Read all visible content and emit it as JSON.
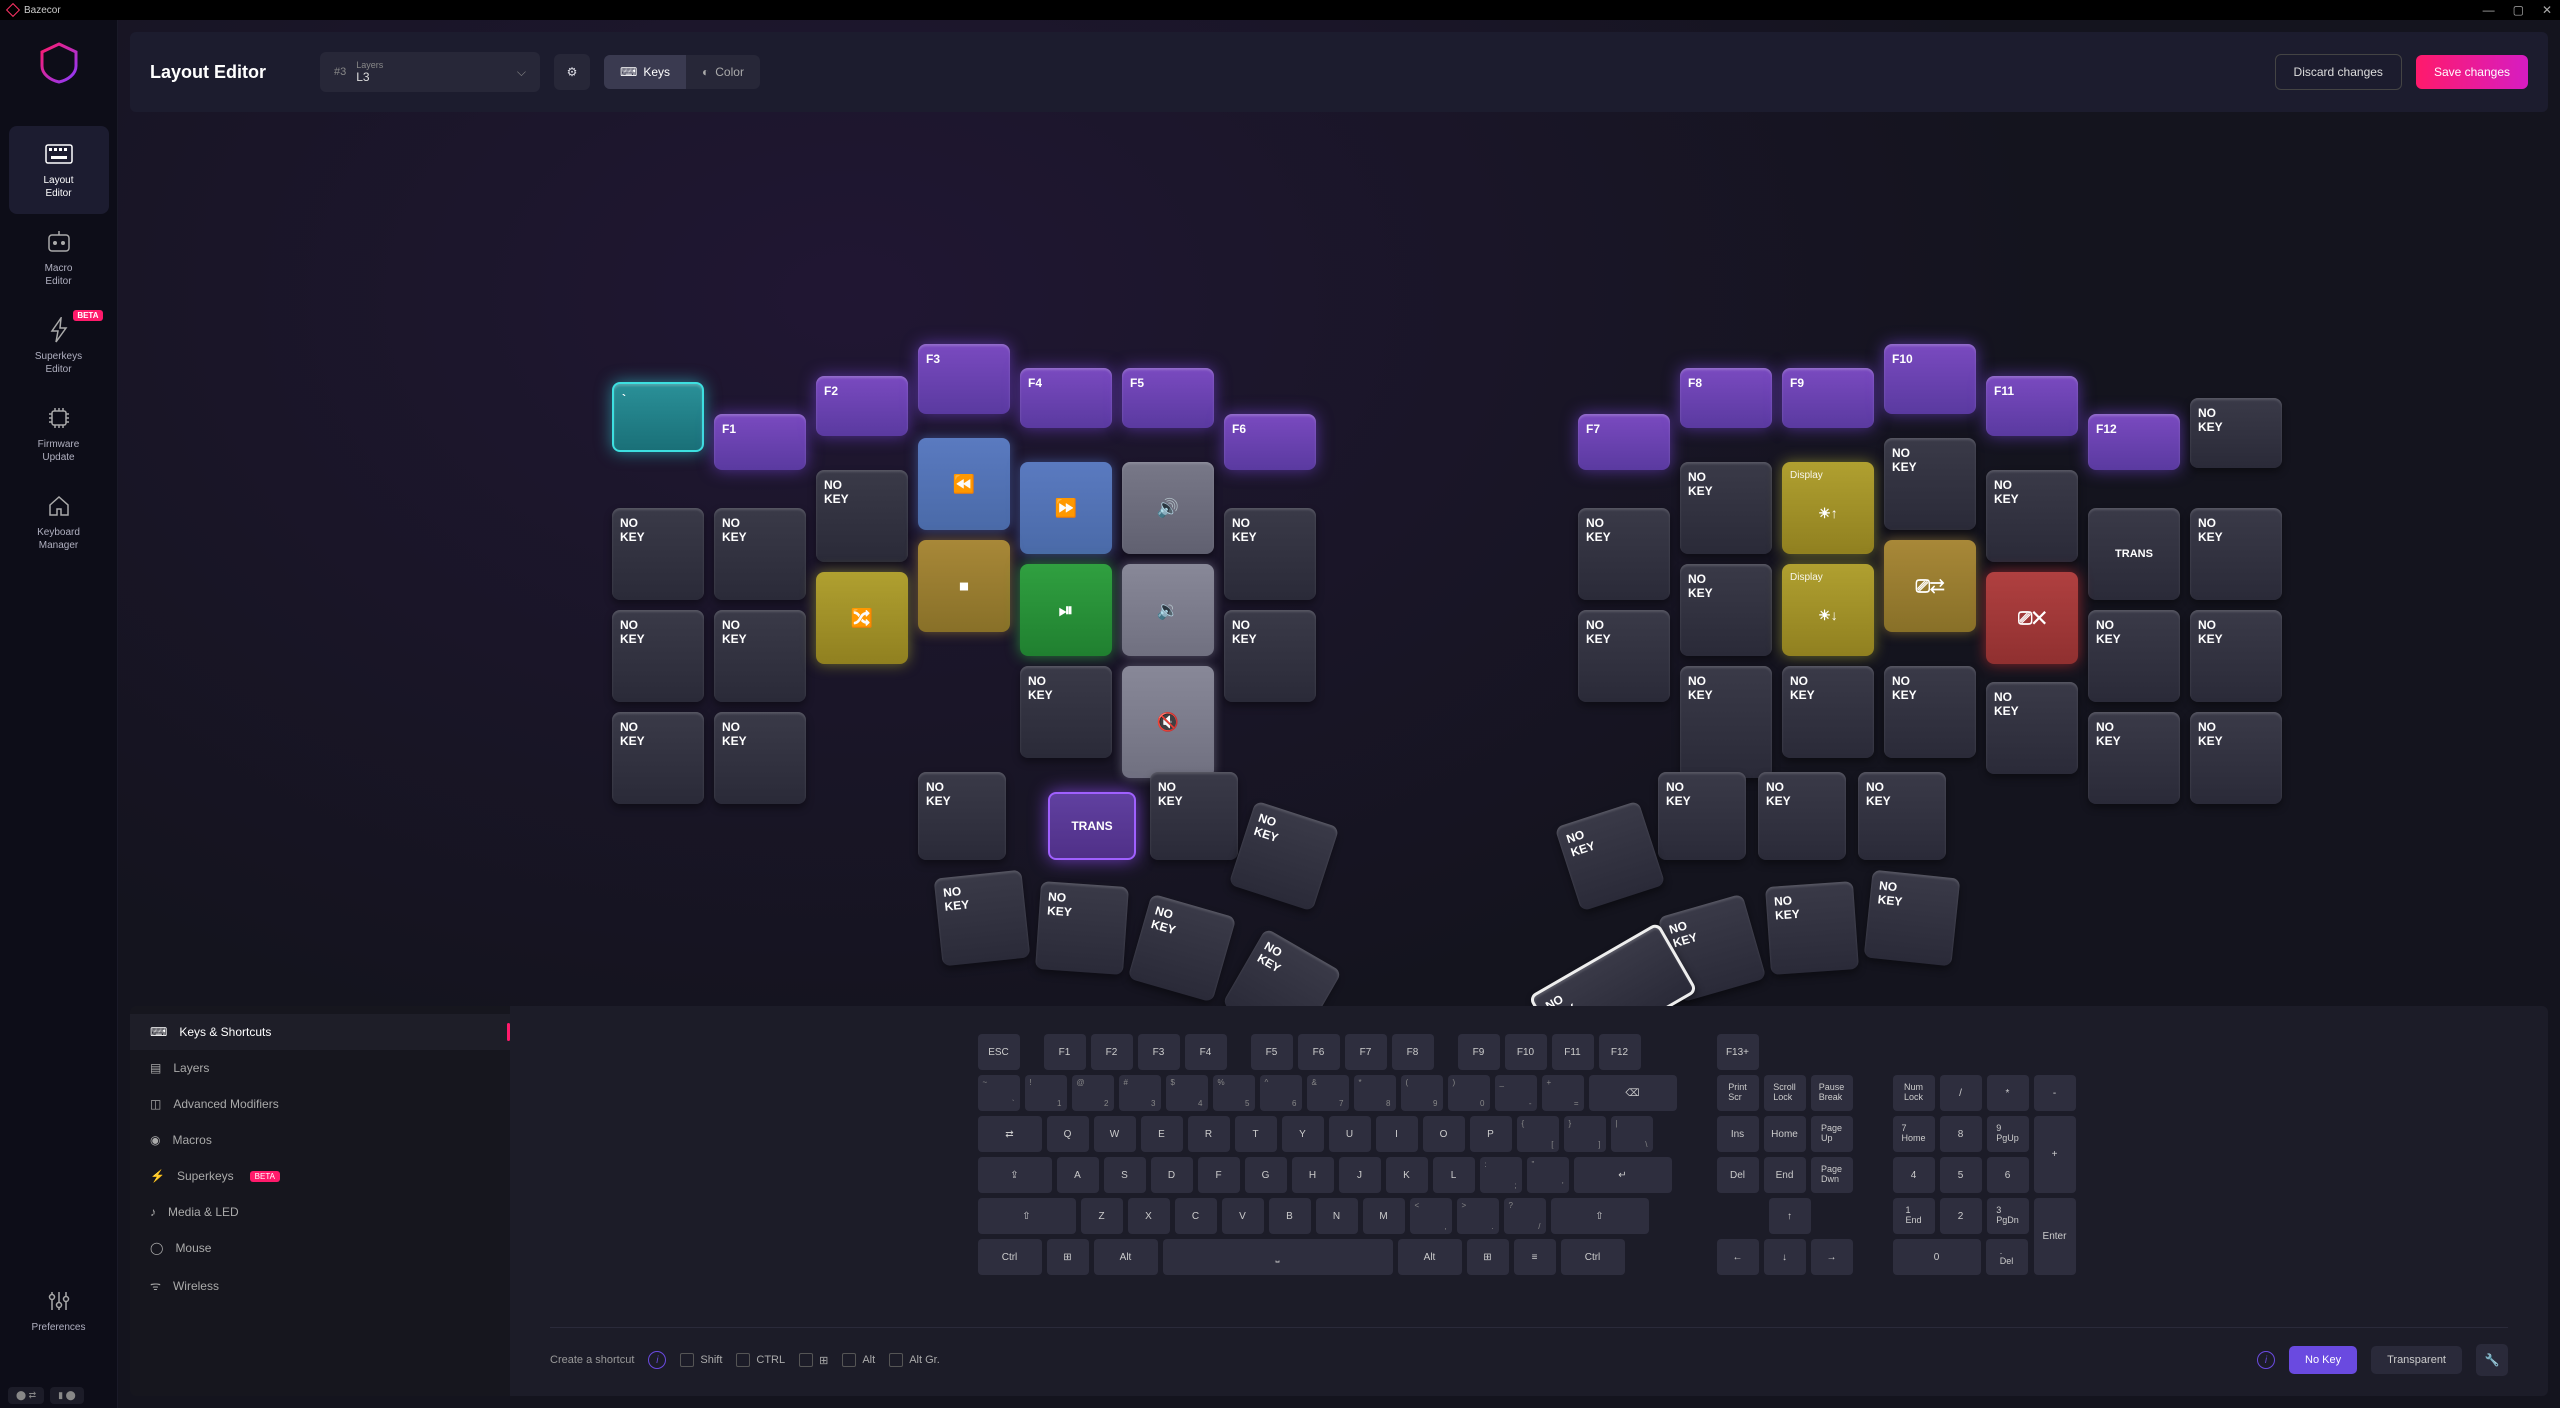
{
  "app": {
    "title": "Bazecor"
  },
  "nav": {
    "items": [
      {
        "label": "Layout\nEditor",
        "active": true
      },
      {
        "label": "Macro\nEditor"
      },
      {
        "label": "Superkeys\nEditor",
        "beta": true
      },
      {
        "label": "Firmware\nUpdate"
      },
      {
        "label": "Keyboard\nManager"
      }
    ],
    "preferences": "Preferences"
  },
  "topbar": {
    "title": "Layout Editor",
    "layer_num": "#3",
    "layer_small": "Layers",
    "layer_name": "L3",
    "keys": "Keys",
    "color": "Color",
    "discard": "Discard changes",
    "save": "Save changes"
  },
  "keys": {
    "nokey": "NO\nKEY",
    "trans": "TRANS",
    "display": "Display",
    "f1": "F1",
    "f2": "F2",
    "f3": "F3",
    "f4": "F4",
    "f5": "F5",
    "f6": "F6",
    "f7": "F7",
    "f8": "F8",
    "f9": "F9",
    "f10": "F10",
    "f11": "F11",
    "f12": "F12",
    "backtick": "`"
  },
  "panel": {
    "tabs": [
      "Keys & Shortcuts",
      "Layers",
      "Advanced Modifiers",
      "Macros",
      "Superkeys",
      "Media & LED",
      "Mouse",
      "Wireless"
    ]
  },
  "vk": {
    "esc": "ESC",
    "frow": [
      "F1",
      "F2",
      "F3",
      "F4",
      "F5",
      "F6",
      "F7",
      "F8",
      "F9",
      "F10",
      "F11",
      "F12"
    ],
    "f13": "F13+",
    "numrow": [
      {
        "m": "`",
        "s": "~"
      },
      {
        "m": "1",
        "s": "!"
      },
      {
        "m": "2",
        "s": "@"
      },
      {
        "m": "3",
        "s": "#"
      },
      {
        "m": "4",
        "s": "$"
      },
      {
        "m": "5",
        "s": "%"
      },
      {
        "m": "6",
        "s": "^"
      },
      {
        "m": "7",
        "s": "&"
      },
      {
        "m": "8",
        "s": "*"
      },
      {
        "m": "9",
        "s": "("
      },
      {
        "m": "0",
        "s": ")"
      },
      {
        "m": "-",
        "s": "_"
      },
      {
        "m": "=",
        "s": "+"
      }
    ],
    "row2": [
      "Q",
      "W",
      "E",
      "R",
      "T",
      "Y",
      "U",
      "I",
      "O",
      "P"
    ],
    "row2_brackets": [
      {
        "m": "[",
        "s": "{"
      },
      {
        "m": "]",
        "s": "}"
      },
      {
        "m": "\\",
        "s": "|"
      }
    ],
    "row3": [
      "A",
      "S",
      "D",
      "F",
      "G",
      "H",
      "J",
      "K",
      "L"
    ],
    "row3_end": [
      {
        "m": ";",
        "s": ":"
      },
      {
        "m": "'",
        "s": "\""
      }
    ],
    "row4": [
      "Z",
      "X",
      "C",
      "V",
      "B",
      "N",
      "M"
    ],
    "row4_end": [
      {
        "m": ",",
        "s": "<"
      },
      {
        "m": ".",
        "s": ">"
      },
      {
        "m": "/",
        "s": "?"
      }
    ],
    "ctrl": "Ctrl",
    "alt": "Alt",
    "nav": {
      "printscr": "Print\nScr",
      "scrolllock": "Scroll\nLock",
      "pausebreak": "Pause\nBreak",
      "numlock": "Num\nLock",
      "ins": "Ins",
      "home": "Home",
      "pgup": "Page\nUp",
      "del": "Del",
      "end": "End",
      "pgdn": "Page\nDwn",
      "k7": "7\nHome",
      "k8": "8",
      "k9": "9\nPgUp",
      "k4": "4",
      "k5": "5",
      "k6": "6",
      "k1": "1\nEnd",
      "k2": "2",
      "k3": "3\nPgDn",
      "k0": "0",
      "kdot": ".\nDel",
      "enter": "Enter",
      "slash": "/",
      "star": "*",
      "minus": "-",
      "plus": "+"
    }
  },
  "footer": {
    "create": "Create a shortcut",
    "shift": "Shift",
    "ctrl": "CTRL",
    "alt": "Alt",
    "altgr": "Alt Gr.",
    "nokey": "No Key",
    "transparent": "Transparent"
  }
}
